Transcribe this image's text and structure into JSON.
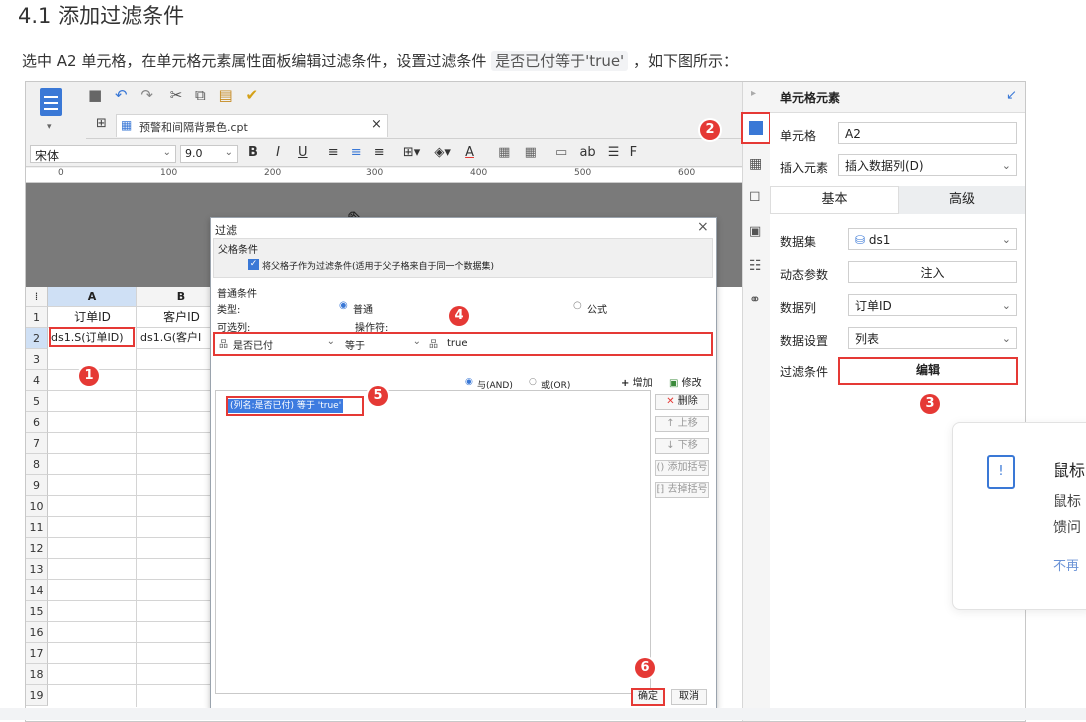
{
  "heading": "4.1 添加过滤条件",
  "intro_before": "选中 A2 单元格，在单元格元素属性面板编辑过滤条件，设置过滤条件",
  "intro_code": "是否已付等于'true'",
  "intro_after": "，如下图所示：",
  "designer": {
    "file_tab": "预警和间隔背景色.cpt",
    "font_name": "宋体",
    "font_size": "9.0",
    "ruler": [
      "0",
      "100",
      "200",
      "300",
      "400",
      "500",
      "600"
    ],
    "columns": [
      "A",
      "B"
    ],
    "rows": [
      "1",
      "2",
      "3",
      "4",
      "5",
      "6",
      "7",
      "8",
      "9",
      "10",
      "11",
      "12",
      "13",
      "14",
      "15",
      "16",
      "17",
      "18",
      "19"
    ],
    "cells": {
      "a1": "订单ID",
      "b1": "客户ID",
      "a2": "ds1.S(订单ID)",
      "b2": "ds1.G(客户I"
    }
  },
  "filter_dialog": {
    "title": "过滤",
    "parent_section": "父格条件",
    "parent_checkbox": "将父格子作为过滤条件(适用于父子格来自于同一个数据集)",
    "normal_section": "普通条件",
    "type_label": "类型:",
    "type_normal": "普通",
    "type_formula": "公式",
    "optional_col_label": "可选列:",
    "operator_label": "操作符:",
    "column_value": "是否已付",
    "operator_value": "等于",
    "value": "true",
    "and_label": "与(AND)",
    "or_label": "或(OR)",
    "add_btn": "增加",
    "modify_btn": "修改",
    "delete_btn": "删除",
    "up_btn": "上移",
    "down_btn": "下移",
    "add_bracket_btn": "添加括号",
    "remove_bracket_btn": "去掉括号",
    "condition_item": "(列名:是否已付) 等于 'true'",
    "ok_btn": "确定",
    "cancel_btn": "取消"
  },
  "property_panel": {
    "title": "单元格元素",
    "cell_label": "单元格",
    "cell_value": "A2",
    "insert_label": "插入元素",
    "insert_value": "插入数据列(D)",
    "tab_basic": "基本",
    "tab_advanced": "高级",
    "dataset_label": "数据集",
    "dataset_value": "ds1",
    "param_label": "动态参数",
    "param_value": "注入",
    "column_label": "数据列",
    "column_value": "订单ID",
    "setting_label": "数据设置",
    "setting_value": "列表",
    "filter_label": "过滤条件",
    "filter_value": "编辑"
  },
  "badges": [
    "1",
    "2",
    "3",
    "4",
    "5",
    "6"
  ],
  "toast": {
    "title": "鼠标",
    "line1": "鼠标",
    "line2": "馈问",
    "link": "不再"
  },
  "colors": {
    "accent": "#2b6cd4",
    "highlight_red": "#e53935",
    "selection_blue": "#3d7be0"
  }
}
